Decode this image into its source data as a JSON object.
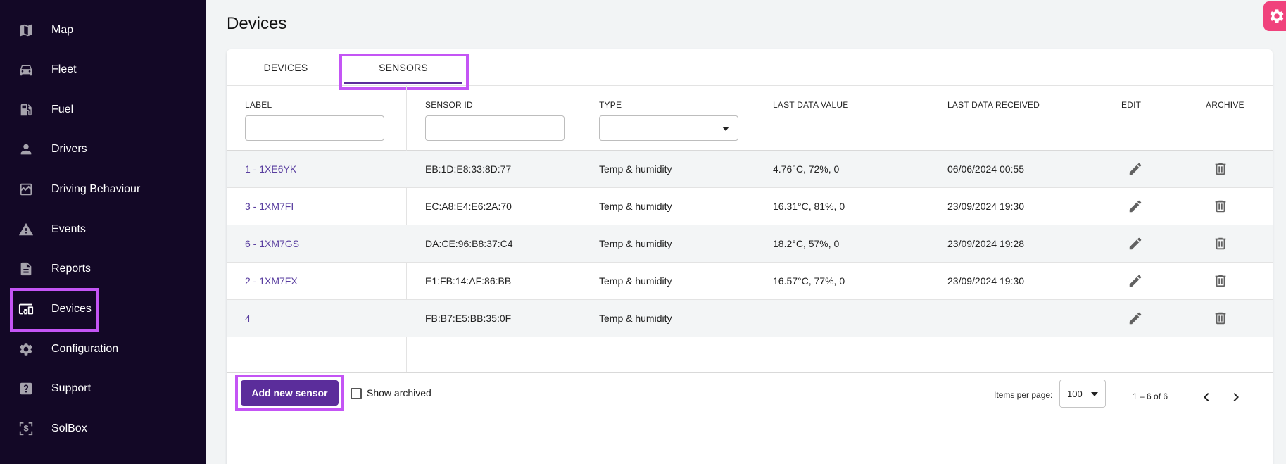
{
  "sidebar": {
    "items": [
      {
        "label": "Map",
        "icon": "map-icon"
      },
      {
        "label": "Fleet",
        "icon": "car-icon"
      },
      {
        "label": "Fuel",
        "icon": "fuel-icon"
      },
      {
        "label": "Drivers",
        "icon": "person-icon"
      },
      {
        "label": "Driving Behaviour",
        "icon": "chart-icon"
      },
      {
        "label": "Events",
        "icon": "warning-icon"
      },
      {
        "label": "Reports",
        "icon": "document-icon"
      },
      {
        "label": "Devices",
        "icon": "devices-icon",
        "active": true
      },
      {
        "label": "Configuration",
        "icon": "gear-icon"
      },
      {
        "label": "Support",
        "icon": "help-icon"
      },
      {
        "label": "SolBox",
        "icon": "solbox-icon"
      }
    ]
  },
  "page": {
    "title": "Devices"
  },
  "tabs": [
    {
      "label": "DEVICES"
    },
    {
      "label": "SENSORS",
      "active": true
    }
  ],
  "table": {
    "columns": [
      "LABEL",
      "SENSOR ID",
      "TYPE",
      "LAST DATA VALUE",
      "LAST DATA RECEIVED",
      "EDIT",
      "ARCHIVE"
    ],
    "filters": {
      "label": "",
      "sensor_id": "",
      "type": ""
    },
    "rows": [
      {
        "label": "1 - 1XE6YK",
        "sensor_id": "EB:1D:E8:33:8D:77",
        "type": "Temp & humidity",
        "last_value": "4.76°C, 72%, 0",
        "last_received": "06/06/2024 00:55"
      },
      {
        "label": "3 - 1XM7FI",
        "sensor_id": "EC:A8:E4:E6:2A:70",
        "type": "Temp & humidity",
        "last_value": "16.31°C, 81%, 0",
        "last_received": "23/09/2024 19:30"
      },
      {
        "label": "6 - 1XM7GS",
        "sensor_id": "DA:CE:96:B8:37:C4",
        "type": "Temp & humidity",
        "last_value": "18.2°C, 57%, 0",
        "last_received": "23/09/2024 19:28"
      },
      {
        "label": "2 - 1XM7FX",
        "sensor_id": "E1:FB:14:AF:86:BB",
        "type": "Temp & humidity",
        "last_value": "16.57°C, 77%, 0",
        "last_received": "23/09/2024 19:30"
      },
      {
        "label": "4",
        "sensor_id": "FB:B7:E5:BB:35:0F",
        "type": "Temp & humidity",
        "last_value": "",
        "last_received": ""
      }
    ]
  },
  "footer": {
    "add_button": "Add new sensor",
    "show_archived": "Show archived",
    "items_per_page_label": "Items per page:",
    "items_per_page_value": "100",
    "range": "1 – 6 of 6"
  },
  "colors": {
    "sidebar_bg": "#130826",
    "accent": "#5b2d9b",
    "highlight": "#c455f5",
    "fab": "#f0427c"
  }
}
